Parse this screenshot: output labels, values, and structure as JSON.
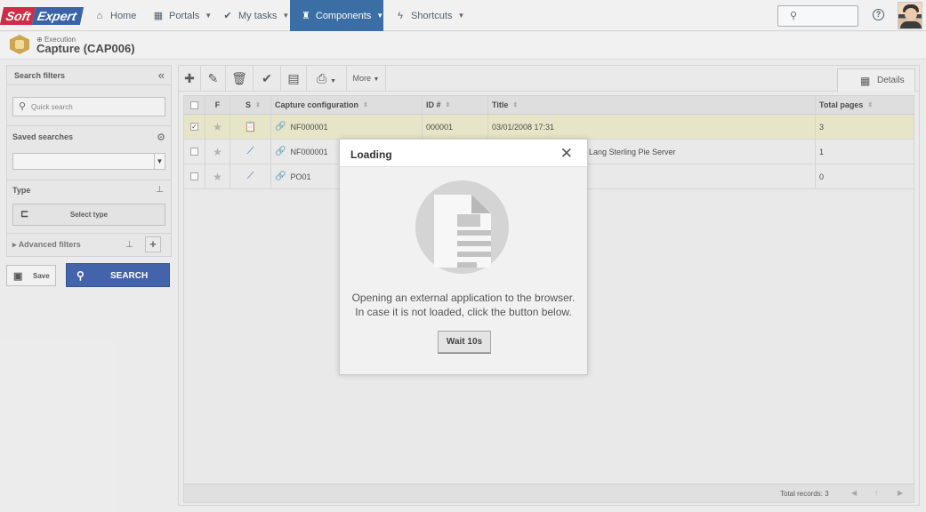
{
  "topnav": {
    "logo_soft": "Soft",
    "logo_expert": "Expert",
    "items": [
      {
        "label": "Home",
        "icon": "home-icon"
      },
      {
        "label": "Portals",
        "icon": "grid-icon"
      },
      {
        "label": "My tasks",
        "icon": "check-icon"
      },
      {
        "label": "Components",
        "icon": "trophy-icon",
        "active": true
      },
      {
        "label": "Shortcuts",
        "icon": "lightning-icon"
      }
    ],
    "search_placeholder": ""
  },
  "page": {
    "breadcrumb": "Execution",
    "title": "Capture (CAP006)"
  },
  "left_panel": {
    "title": "Search filters",
    "quick_search_placeholder": "Quick search",
    "saved_searches_label": "Saved searches",
    "saved_searches_value": "",
    "type_label": "Type",
    "select_type_label": "Select type",
    "advanced_filters_label": "Advanced filters",
    "save_label": "Save",
    "search_label": "SEARCH"
  },
  "toolbar": {
    "more_label": "More",
    "details_label": "Details"
  },
  "grid": {
    "columns": [
      "F",
      "S",
      "Capture configuration",
      "ID #",
      "Title",
      "Total pages"
    ],
    "rows": [
      {
        "checked": true,
        "config": "NF000001",
        "id": "000001",
        "title": "03/01/2008 17:31",
        "pages": "3"
      },
      {
        "checked": false,
        "config": "NF000001",
        "id": "",
        "title": "Lang Sterling Pie Server",
        "pages": "1"
      },
      {
        "checked": false,
        "config": "PO01",
        "id": "",
        "title": "",
        "pages": "0"
      }
    ],
    "footer_total": "Total records: 3"
  },
  "modal": {
    "title": "Loading",
    "message_line1": "Opening an external application to the browser.",
    "message_line2": "In case it is not loaded, click the button below.",
    "button_label": "Wait 10s"
  },
  "colors": {
    "nav_active": "#1f5a99",
    "search_button": "#2a4ea0",
    "selected_row": "#e4e2c0",
    "logo_red": "#c8102e",
    "logo_blue": "#1f4e9c"
  }
}
